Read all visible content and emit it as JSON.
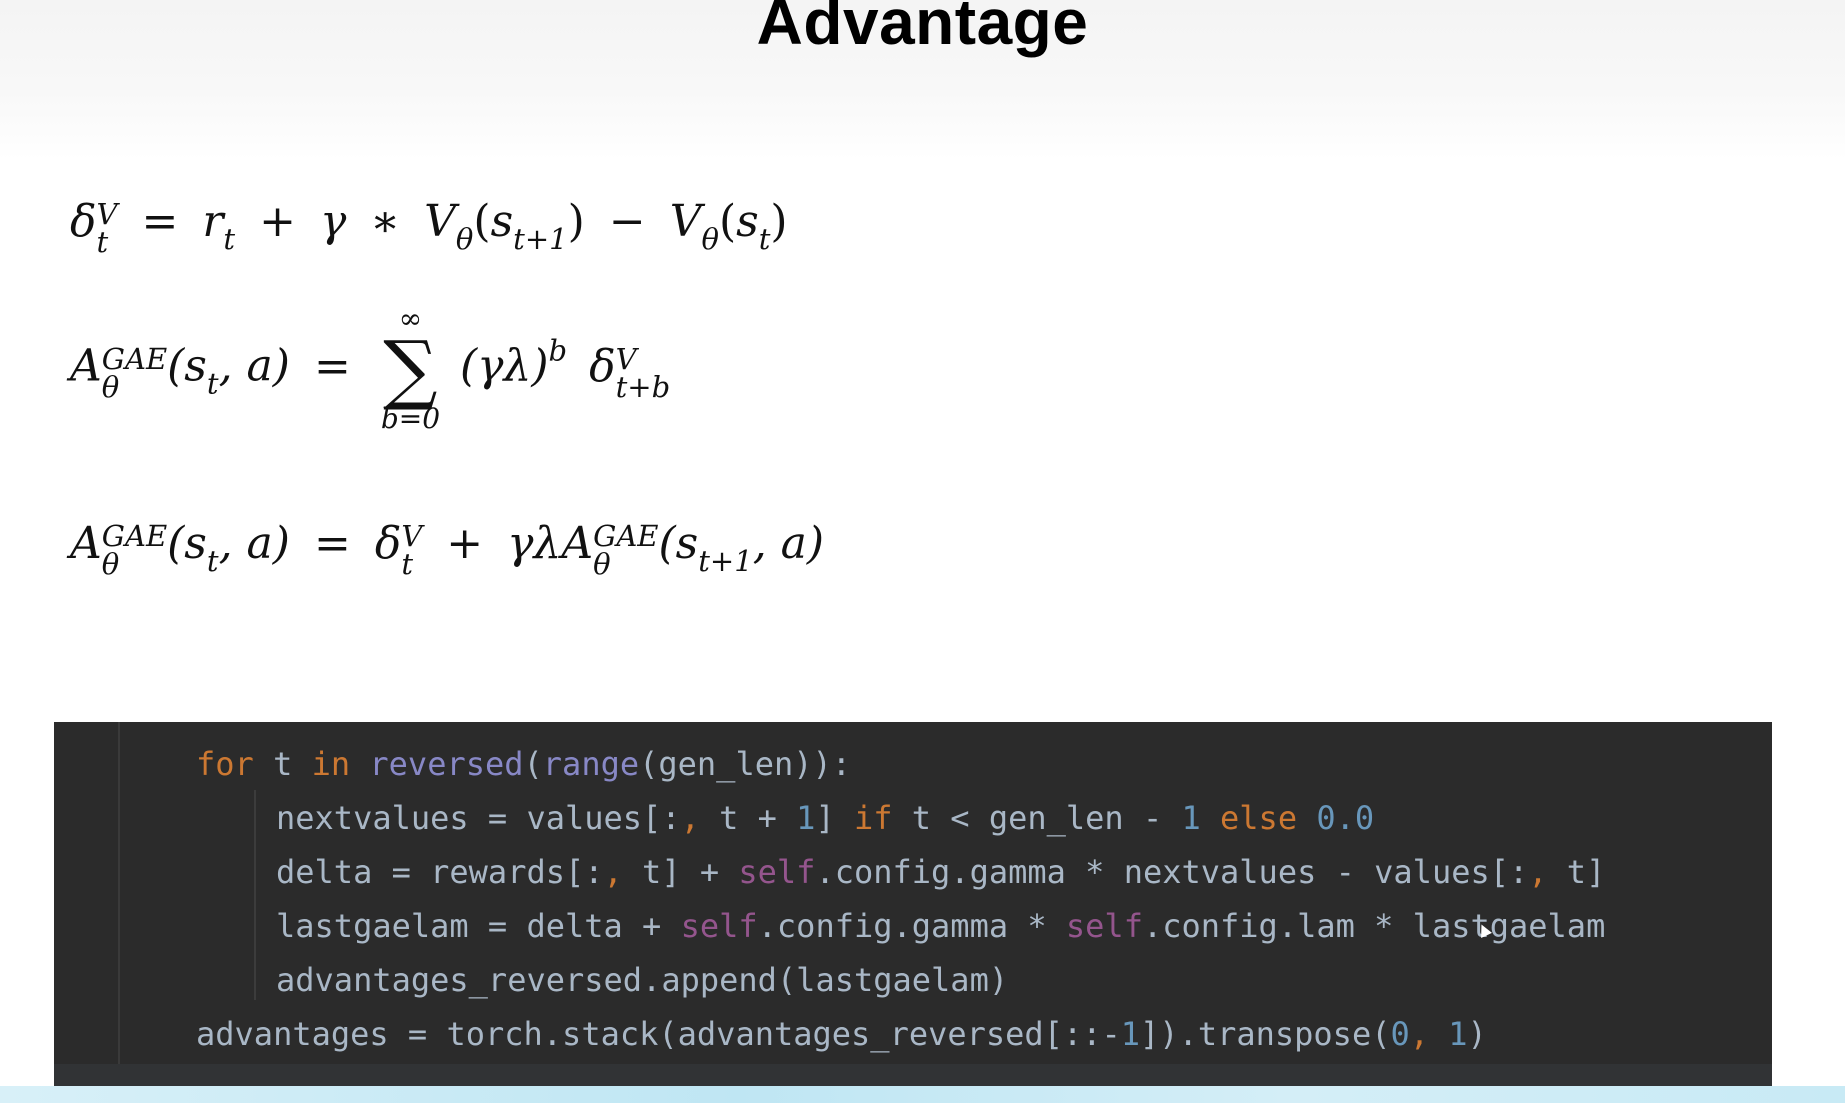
{
  "slide": {
    "title": "Advantage"
  },
  "equations": {
    "eq1": {
      "delta": "δ",
      "delta_sup": "V",
      "delta_sub": "t",
      "equals": "=",
      "r": "r",
      "r_sub": "t",
      "plus": "+",
      "gamma": "γ",
      "star": "∗",
      "V": "V",
      "theta": "θ",
      "open": "(",
      "s": "s",
      "s_sub_next": "t+1",
      "close": ")",
      "minus": "−",
      "s_sub": "t"
    },
    "eq2": {
      "A": "A",
      "A_sup": "GAE",
      "A_sub": "θ",
      "args": "(s",
      "args_sub": "t",
      "args_end": ", a)",
      "equals": "=",
      "sum_upper": "∞",
      "sum_symbol": "∑",
      "sum_lower": "b=0",
      "term": "(γλ)",
      "term_sup": "b",
      "delta": "δ",
      "delta_sup": "V",
      "delta_sub": "t+b"
    },
    "eq3": {
      "A": "A",
      "A_sup": "GAE",
      "A_sub": "θ",
      "args": "(s",
      "args_sub": "t",
      "args_end": ", a)",
      "equals": "=",
      "delta": "δ",
      "delta_sup": "V",
      "delta_sub": "t",
      "plus": "+",
      "coef": "γλA",
      "A2_sup": "GAE",
      "A2_sub": "θ",
      "args2": "(s",
      "args2_sub": "t+1",
      "args2_end": ", a)"
    }
  },
  "code": {
    "line1": {
      "for": "for",
      "t": " t ",
      "in": "in",
      "sp": " ",
      "reversed": "reversed",
      "p1": "(",
      "range": "range",
      "rest": "(gen_len)):"
    },
    "line2": {
      "a": "nextvalues = values[:",
      "comma": ",",
      "b": " t + ",
      "one": "1",
      "c": "] ",
      "if": "if",
      "d": " t < gen_len - ",
      "one2": "1",
      "sp": " ",
      "else": "else",
      "sp2": " ",
      "zero": "0.0"
    },
    "line3": {
      "a": "delta = rewards[:",
      "comma": ",",
      "b": " t] + ",
      "self": "self",
      "c": ".config.gamma * nextvalues - values[:",
      "comma2": ",",
      "d": " t]"
    },
    "line4": {
      "a": "lastgaelam = delta + ",
      "self": "self",
      "b": ".config.gamma * ",
      "self2": "self",
      "c": ".config.lam * lastgaelam"
    },
    "line5": {
      "a": "advantages_reversed.append(lastgaelam)"
    },
    "line6": {
      "a": "advantages = torch.stack(advantages_reversed[::-",
      "one": "1",
      "b": "]).transpose(",
      "zero": "0",
      "comma": ",",
      "sp": " ",
      "one2": "1",
      "c": ")"
    }
  },
  "colors": {
    "code_background": "#2b2b2b",
    "keyword": "#cc7832",
    "builtin": "#8888c6",
    "number": "#6897bb",
    "self": "#94558d",
    "default_text": "#a9b7c6"
  }
}
